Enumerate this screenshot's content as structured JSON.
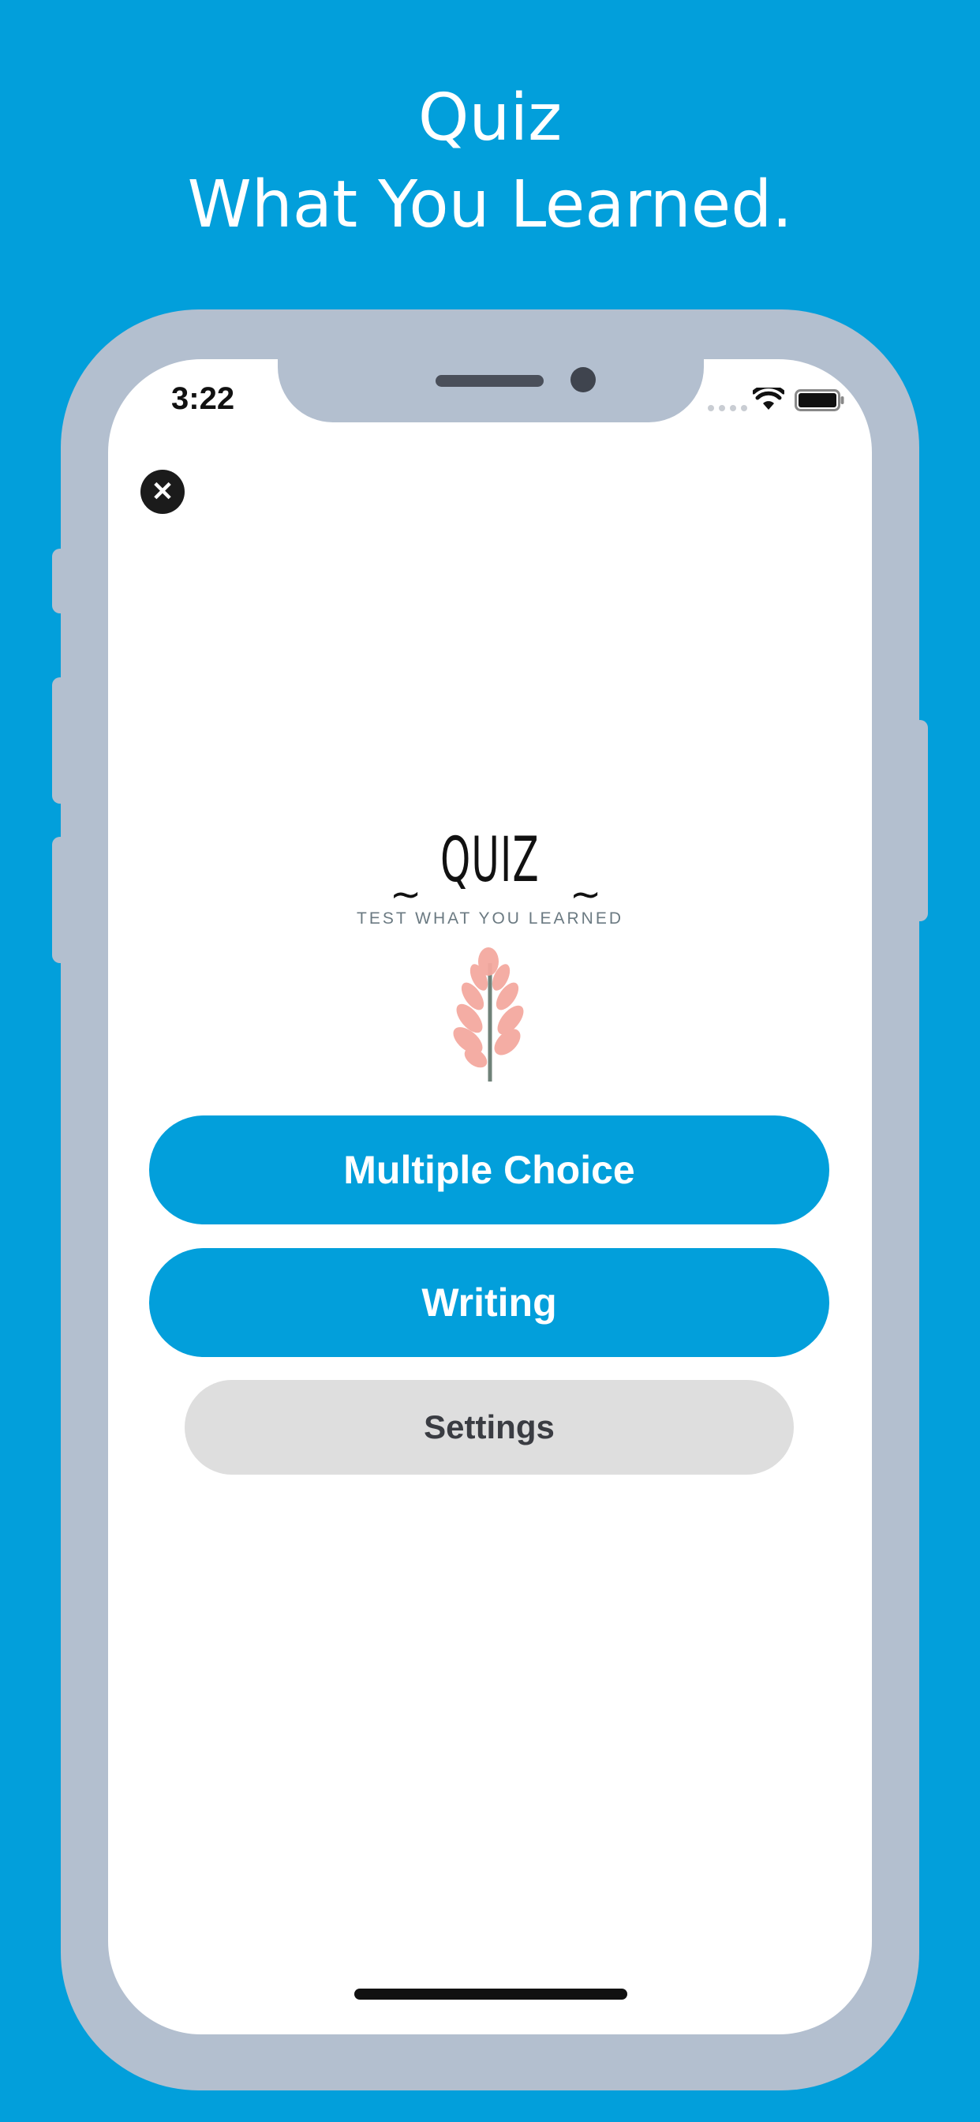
{
  "headline": {
    "line1": "Quiz",
    "line2": "What You Learned."
  },
  "status_bar": {
    "time": "3:22"
  },
  "close_button": {
    "symbol": "✕",
    "icon": "close-icon"
  },
  "logo": {
    "title": "QUIZ",
    "tilde_left": "~",
    "tilde_right": "~",
    "subtitle": "TEST WHAT YOU LEARNED"
  },
  "buttons": {
    "multiple_choice": "Multiple Choice",
    "writing": "Writing",
    "settings": "Settings"
  },
  "colors": {
    "background": "#029fdb",
    "phone_frame": "#b3bfcf",
    "primary_button": "#029fdb",
    "secondary_button": "#dedede",
    "flower": "#f4a9a0"
  }
}
